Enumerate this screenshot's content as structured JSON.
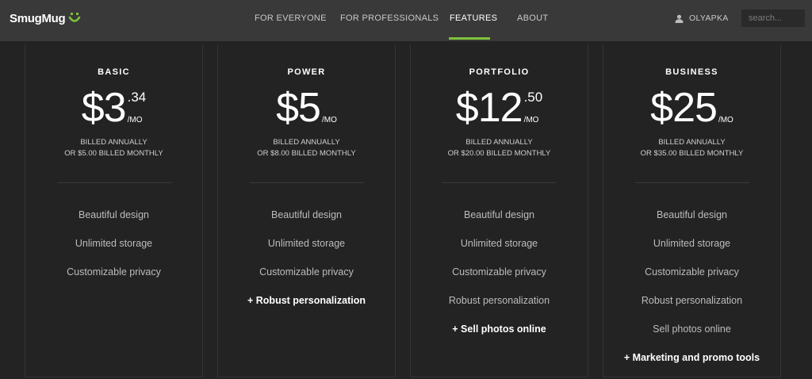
{
  "brand": {
    "name": "SmugMug"
  },
  "nav": {
    "items": [
      "FOR EVERYONE",
      "FOR PROFESSIONALS",
      "FEATURES",
      "ABOUT"
    ],
    "active_index": 2,
    "accent_color": "#7ec13c"
  },
  "user": {
    "name": "OLYAPKA",
    "icon": "user-icon"
  },
  "search": {
    "placeholder": "search..."
  },
  "plans": [
    {
      "name": "BASIC",
      "price_main": "$3",
      "price_cents": ".34",
      "unit": "/MO",
      "billing_line1": "BILLED ANNUALLY",
      "billing_line2": "OR $5.00 BILLED MONTHLY",
      "features": [
        {
          "text": "Beautiful design",
          "highlight": false
        },
        {
          "text": "Unlimited storage",
          "highlight": false
        },
        {
          "text": "Customizable privacy",
          "highlight": false
        }
      ]
    },
    {
      "name": "POWER",
      "price_main": "$5",
      "price_cents": "",
      "unit": "/MO",
      "billing_line1": "BILLED ANNUALLY",
      "billing_line2": "OR $8.00 BILLED MONTHLY",
      "features": [
        {
          "text": "Beautiful design",
          "highlight": false
        },
        {
          "text": "Unlimited storage",
          "highlight": false
        },
        {
          "text": "Customizable privacy",
          "highlight": false
        },
        {
          "text": "+ Robust personalization",
          "highlight": true
        }
      ]
    },
    {
      "name": "PORTFOLIO",
      "price_main": "$12",
      "price_cents": ".50",
      "unit": "/MO",
      "billing_line1": "BILLED ANNUALLY",
      "billing_line2": "OR $20.00 BILLED MONTHLY",
      "features": [
        {
          "text": "Beautiful design",
          "highlight": false
        },
        {
          "text": "Unlimited storage",
          "highlight": false
        },
        {
          "text": "Customizable privacy",
          "highlight": false
        },
        {
          "text": "Robust personalization",
          "highlight": false
        },
        {
          "text": "+ Sell photos online",
          "highlight": true
        }
      ]
    },
    {
      "name": "BUSINESS",
      "price_main": "$25",
      "price_cents": "",
      "unit": "/MO",
      "billing_line1": "BILLED ANNUALLY",
      "billing_line2": "OR $35.00 BILLED MONTHLY",
      "features": [
        {
          "text": "Beautiful design",
          "highlight": false
        },
        {
          "text": "Unlimited storage",
          "highlight": false
        },
        {
          "text": "Customizable privacy",
          "highlight": false
        },
        {
          "text": "Robust personalization",
          "highlight": false
        },
        {
          "text": "Sell photos online",
          "highlight": false
        },
        {
          "text": "+ Marketing and promo tools",
          "highlight": true
        }
      ]
    }
  ]
}
